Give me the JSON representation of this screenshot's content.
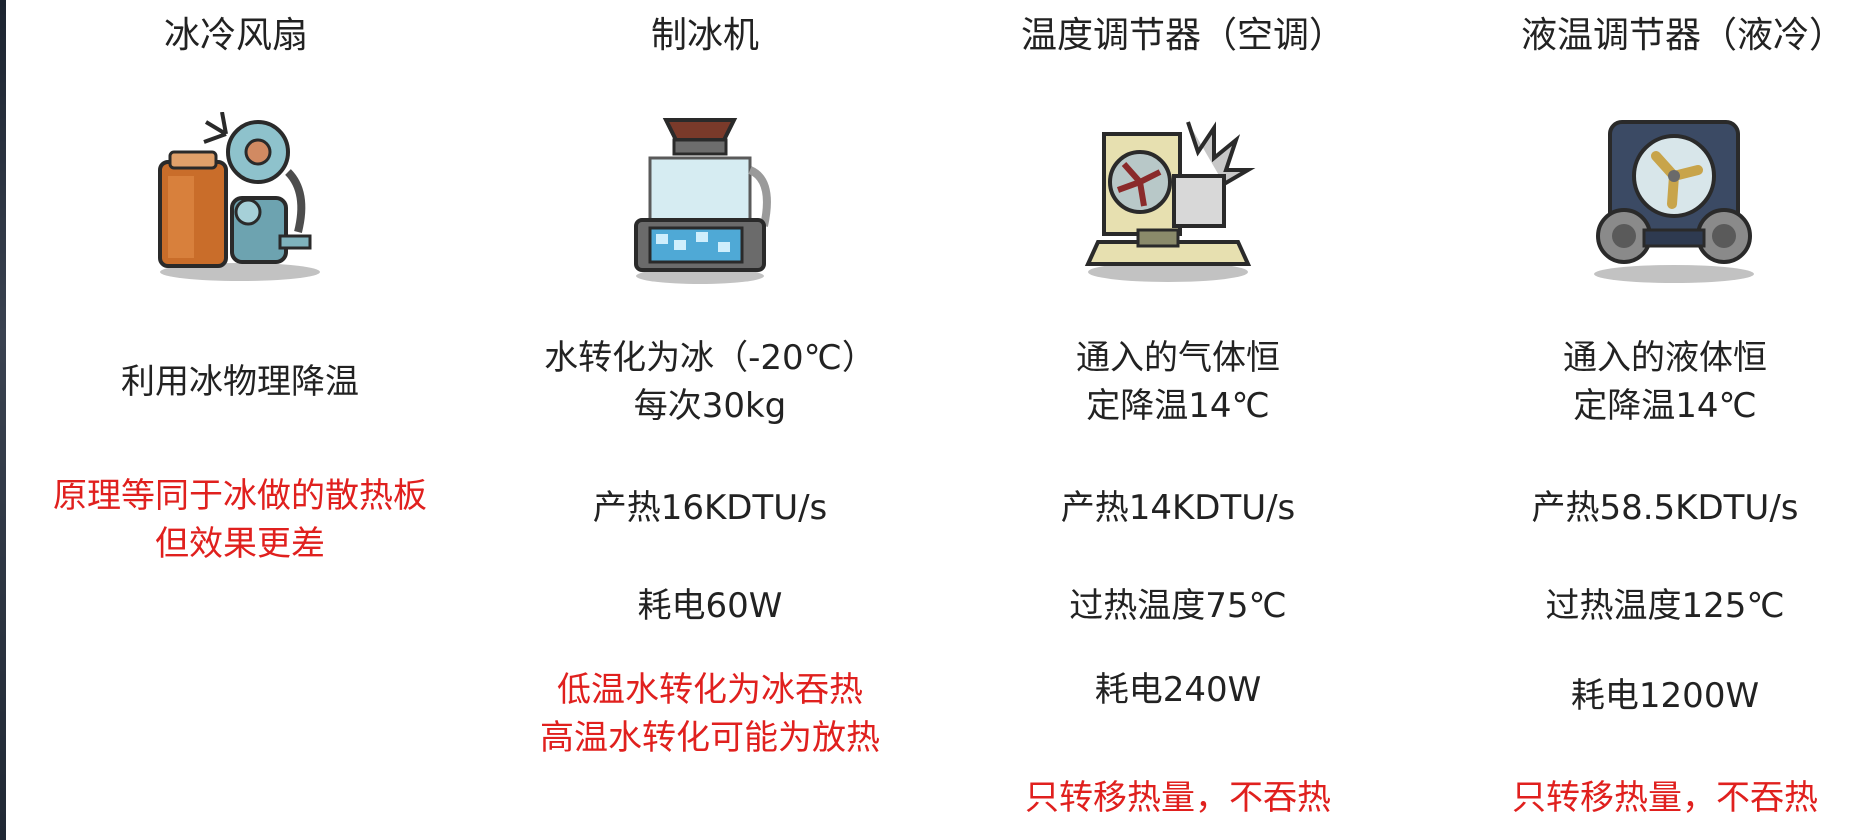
{
  "columns": [
    {
      "title": "冰冷风扇",
      "icon": "ice-fan-icon",
      "desc": [
        "利用冰物理降温"
      ],
      "stats": [],
      "notes": [
        "原理等同于冰做的散热板",
        "但效果更差"
      ]
    },
    {
      "title": "制冰机",
      "icon": "ice-maker-icon",
      "desc": [
        "水转化为冰（-20℃）",
        "每次30kg"
      ],
      "stats": [
        "产热16KDTU/s",
        "耗电60W"
      ],
      "notes": [
        "低温水转化为冰吞热",
        "高温水转化可能为放热"
      ]
    },
    {
      "title": "温度调节器（空调）",
      "icon": "thermo-regulator-icon",
      "desc": [
        "通入的气体恒",
        "定降温14℃"
      ],
      "stats": [
        "产热14KDTU/s",
        "过热温度75℃",
        "耗电240W"
      ],
      "notes": [
        "只转移热量，不吞热"
      ]
    },
    {
      "title": "液温调节器（液冷）",
      "icon": "thermo-aquatuner-icon",
      "desc": [
        "通入的液体恒",
        "定降温14℃"
      ],
      "stats": [
        "产热58.5KDTU/s",
        "过热温度125℃",
        "耗电1200W"
      ],
      "notes": [
        "只转移热量，不吞热"
      ]
    }
  ]
}
